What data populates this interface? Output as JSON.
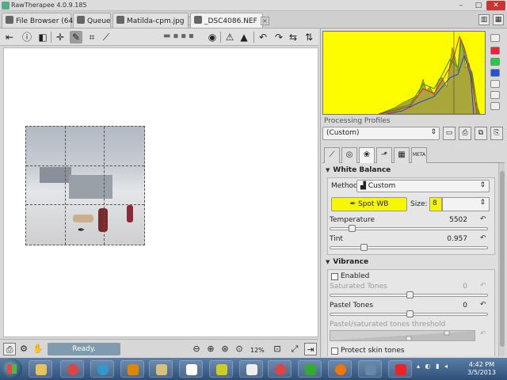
{
  "window": {
    "title": "RawTherapee 4.0.9.185"
  },
  "tabs": [
    {
      "label": "File Browser (64)",
      "icon": "folder-icon"
    },
    {
      "label": "Queue",
      "icon": "gears-icon"
    },
    {
      "label": "Matilda-cpm.jpg",
      "icon": "image-icon"
    },
    {
      "label": "_DSC4086.NEF",
      "icon": "image-icon",
      "active": true
    }
  ],
  "canvas": {
    "background": "#ffffff"
  },
  "bottom": {
    "status": "Ready.",
    "zoom": "12%"
  },
  "processing_profiles": {
    "label": "Processing Profiles",
    "value": "(Custom)"
  },
  "white_balance": {
    "title": "White Balance",
    "method_label": "Method",
    "method_value": "Custom",
    "spot_wb_label": "Spot WB",
    "size_label": "Size:",
    "size_value": "8",
    "temperature_label": "Temperature",
    "temperature_value": "5502",
    "temperature_level": 0.12,
    "tint_label": "Tint",
    "tint_value": "0.957",
    "tint_level": 0.2
  },
  "vibrance": {
    "title": "Vibrance",
    "enabled_label": "Enabled",
    "saturated_label": "Saturated Tones",
    "saturated_value": "0",
    "pastel_label": "Pastel Tones",
    "pastel_value": "0",
    "threshold_label": "Pastel/saturated tones threshold",
    "protect_label": "Protect skin tones"
  },
  "taskbar": {
    "time": "4:42 PM",
    "date": "3/5/2013"
  },
  "colors": {
    "histogram_bg": "#fdfd00",
    "highlight": "#f7f700",
    "status_bg": "#7f9bb0"
  }
}
